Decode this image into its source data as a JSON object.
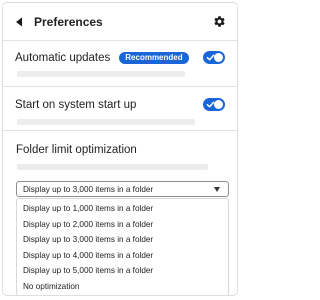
{
  "header": {
    "title": "Preferences",
    "back_icon": "chevron-left-icon",
    "settings_icon": "gear-icon"
  },
  "settings": [
    {
      "label": "Automatic updates",
      "badge": "Recommended",
      "toggle_on": true
    },
    {
      "label": "Start on system start up",
      "toggle_on": true
    }
  ],
  "folder_limit": {
    "label": "Folder limit optimization",
    "selected": "Display up to 3,000 items in a folder",
    "options": [
      "Display up to 1,000 items in a folder",
      "Display up to 2,000 items in a folder",
      "Display up to 3,000 items in a folder",
      "Display up to 4,000 items in a folder",
      "Display up to 5,000 items in a folder",
      "No optimization"
    ]
  },
  "colors": {
    "accent": "#1a66d9",
    "placeholder": "#ececec",
    "divider": "#e2e2e2"
  }
}
